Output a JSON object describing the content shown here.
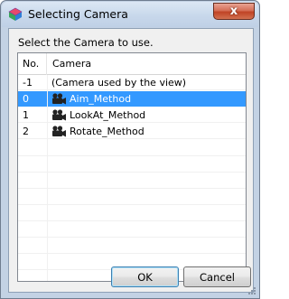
{
  "window": {
    "title": "Selecting Camera",
    "app_icon": "cube-app-icon",
    "close_glyph": "x"
  },
  "instruction": "Select the Camera to use.",
  "list": {
    "columns": [
      "No.",
      "Camera"
    ],
    "rows": [
      {
        "no": "-1",
        "camera": "(Camera used by the view)",
        "icon": "",
        "selected": false
      },
      {
        "no": "0",
        "camera": "Aim_Method",
        "icon": "movie-camera-icon",
        "selected": true
      },
      {
        "no": "1",
        "camera": "LookAt_Method",
        "icon": "movie-camera-icon",
        "selected": false
      },
      {
        "no": "2",
        "camera": "Rotate_Method",
        "icon": "movie-camera-icon",
        "selected": false
      }
    ]
  },
  "buttons": {
    "ok": "OK",
    "cancel": "Cancel"
  },
  "colors": {
    "selection": "#3399ff",
    "frame": "#c3d2e4",
    "close": "#c04425"
  }
}
